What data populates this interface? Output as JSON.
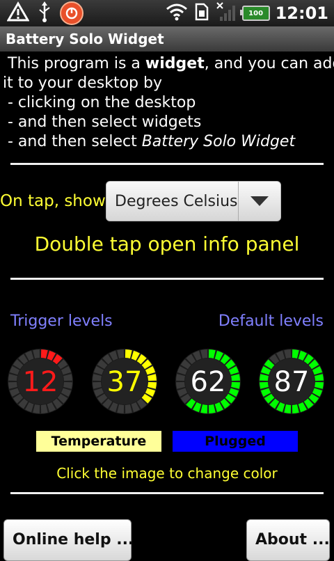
{
  "status_bar": {
    "time": "12:01",
    "battery_level": "100",
    "icons": [
      "warning-icon",
      "usb-icon",
      "app-notification-icon",
      "wifi-icon",
      "sim-icon",
      "no-signal-icon",
      "battery-icon"
    ]
  },
  "title_bar": {
    "title": "Battery Solo Widget"
  },
  "intro": {
    "line1_pre": "This program is a ",
    "line1_bold": "widget",
    "line1_post": ", and you can add",
    "line2": "it to your desktop by",
    "line3": " - clicking on the desktop",
    "line4": " - and then select widgets",
    "line5_pre": " - and then select ",
    "line5_italic": "Battery Solo Widget"
  },
  "on_tap": {
    "label": "On tap, show:",
    "selected": "Degrees Celsius"
  },
  "double_tap_text": "Double tap open info panel",
  "levels": {
    "trigger_label": "Trigger levels",
    "default_label": "Default levels"
  },
  "gauges": [
    {
      "value": "12",
      "level": 0.12,
      "color": "#ff1a1a"
    },
    {
      "value": "37",
      "level": 0.37,
      "color": "#ffff00"
    },
    {
      "value": "62",
      "level": 0.62,
      "color": "#00ff00"
    },
    {
      "value": "87",
      "level": 0.87,
      "color": "#00ff00"
    }
  ],
  "chips": {
    "temperature": "Temperature",
    "plugged": "Plugged"
  },
  "colors": {
    "text_yellow": "#ffff33",
    "label_blue": "#8080ff",
    "chip_temperature_bg": "#ffff99",
    "chip_plugged_bg": "#0000ff"
  },
  "click_hint": "Click the image to change color",
  "buttons": {
    "help": "Online help ...",
    "about": "About ..."
  }
}
